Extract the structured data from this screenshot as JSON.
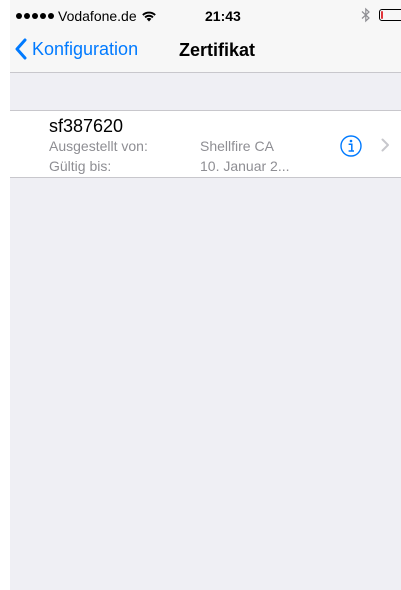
{
  "status_bar": {
    "carrier": "Vodafone.de",
    "time": "21:43"
  },
  "nav": {
    "back_label": "Konfiguration",
    "title": "Zertifikat"
  },
  "certificate": {
    "name": "sf387620",
    "issued_by_label": "Ausgestellt von:",
    "issued_by_value": "Shellfire CA",
    "valid_until_label": "Gültig bis:",
    "valid_until_value": "10. Januar 2..."
  },
  "colors": {
    "accent": "#007aff",
    "secondary_text": "#8e8e93",
    "background": "#efeff4"
  }
}
